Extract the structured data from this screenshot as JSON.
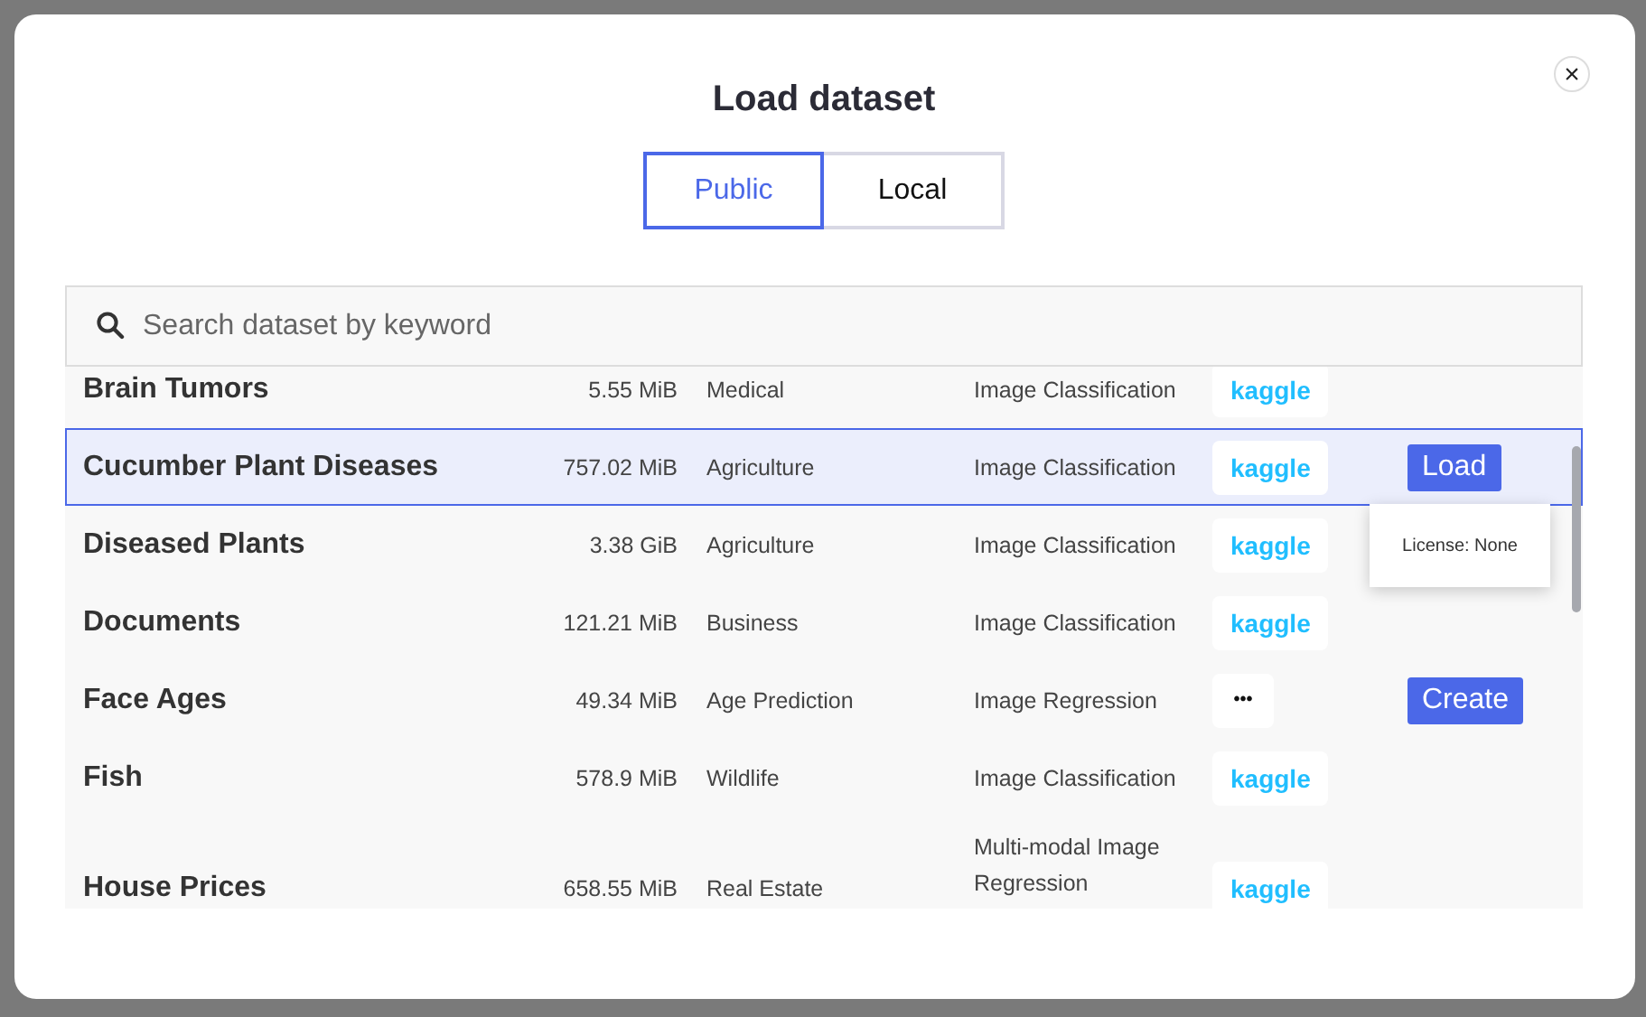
{
  "dialog": {
    "title": "Load dataset",
    "close_label": "×"
  },
  "tabs": [
    {
      "label": "Public",
      "selected": true
    },
    {
      "label": "Local",
      "selected": false
    }
  ],
  "search": {
    "placeholder": "Search dataset by keyword"
  },
  "datasets": [
    {
      "name": "Brain Tumors",
      "size": "5.55 MiB",
      "category": "Medical",
      "task": "Image Classification",
      "source": "kaggle",
      "selected": false
    },
    {
      "name": "Cucumber Plant Diseases",
      "size": "757.02 MiB",
      "category": "Agriculture",
      "task": "Image Classification",
      "source": "kaggle",
      "selected": true,
      "action": "Load",
      "tooltip": "License: None"
    },
    {
      "name": "Diseased Plants",
      "size": "3.38 GiB",
      "category": "Agriculture",
      "task": "Image Classification",
      "source": "kaggle",
      "selected": false
    },
    {
      "name": "Documents",
      "size": "121.21 MiB",
      "category": "Business",
      "task": "Image Classification",
      "source": "kaggle",
      "selected": false
    },
    {
      "name": "Face Ages",
      "size": "49.34 MiB",
      "category": "Age Prediction",
      "task": "Image Regression",
      "source": "•••",
      "selected": false,
      "action": "Create"
    },
    {
      "name": "Fish",
      "size": "578.9 MiB",
      "category": "Wildlife",
      "task": "Image Classification",
      "source": "kaggle",
      "selected": false
    },
    {
      "name": "House Prices",
      "size": "658.55 MiB",
      "category": "Real Estate",
      "task": "Multi-modal Image Regression",
      "source": "kaggle",
      "selected": false
    }
  ]
}
